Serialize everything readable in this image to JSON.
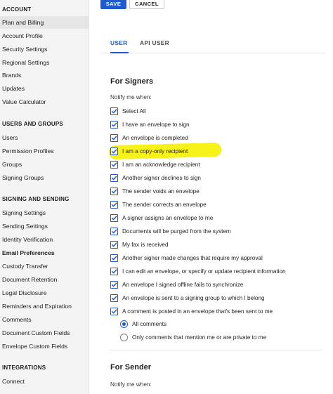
{
  "sidebar": {
    "account": {
      "title": "ACCOUNT",
      "items": [
        "Plan and Billing",
        "Account Profile",
        "Security Settings",
        "Regional Settings",
        "Brands",
        "Updates",
        "Value Calculator"
      ]
    },
    "users_groups": {
      "title": "USERS AND GROUPS",
      "items": [
        "Users",
        "Permission Profiles",
        "Groups",
        "Signing Groups"
      ]
    },
    "signing_sending": {
      "title": "SIGNING AND SENDING",
      "items": [
        "Signing Settings",
        "Sending Settings",
        "Identity Verification",
        "Email Preferences",
        "Custody Transfer",
        "Document Retention",
        "Legal Disclosure",
        "Reminders and Expiration",
        "Comments",
        "Document Custom Fields",
        "Envelope Custom Fields"
      ]
    },
    "integrations": {
      "title": "INTEGRATIONS",
      "items": [
        "Connect"
      ]
    }
  },
  "toolbar": {
    "save_label": "SAVE",
    "cancel_label": "CANCEL"
  },
  "tabs": [
    {
      "label": "USER",
      "active": true
    },
    {
      "label": "API USER",
      "active": false
    }
  ],
  "signers": {
    "title": "For Signers",
    "notify_label": "Notify me when:",
    "options": [
      "Select All",
      "I have an envelope to sign",
      "An envelope is completed",
      "I am a copy-only recipient",
      "I am an acknowledge recipient",
      "Another signer declines to sign",
      "The sender voids an envelope",
      "The sender corrects an envelope",
      "A signer assigns an envelope to me",
      "Documents will be purged from the system",
      "My fax is received",
      "Another signer made changes that require my approval",
      "I can edit an envelope, or specify or update recipient information",
      "An envelope I signed offline fails to synchronize",
      "An envelope is sent to a signing group to which I belong",
      "A comment is posted in an envelope that's been sent to me"
    ],
    "comment_radio": {
      "options": [
        "All comments",
        "Only comments that mention me or are private to me"
      ],
      "selected": "All comments"
    }
  },
  "sender": {
    "title": "For Sender",
    "notify_label": "Notify me when:"
  },
  "colors": {
    "accent": "#1f5bcf",
    "highlight": "#f7f21a",
    "sidebar_bg": "#f4f4f4"
  }
}
